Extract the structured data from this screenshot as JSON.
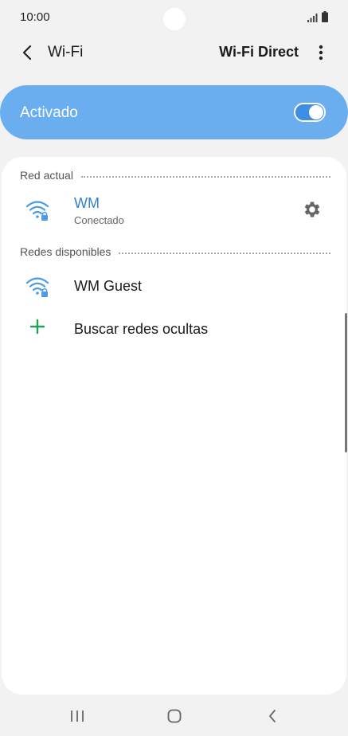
{
  "status_bar": {
    "time": "10:00"
  },
  "app_bar": {
    "title": "Wi-Fi",
    "wifi_direct_label": "Wi-Fi Direct"
  },
  "master_switch": {
    "label": "Activado",
    "state": "on",
    "accent_color": "#6aaef0"
  },
  "current_network": {
    "section_title": "Red actual",
    "name": "WM",
    "status": "Conectado"
  },
  "available_networks": {
    "section_title": "Redes disponibles",
    "items": [
      {
        "name": "WM Guest"
      }
    ]
  },
  "hidden_networks": {
    "label": "Buscar redes ocultas"
  },
  "colors": {
    "wifi_icon": "#4a9be8",
    "add_icon": "#1fa35a",
    "connected_text": "#2f7fd6"
  }
}
